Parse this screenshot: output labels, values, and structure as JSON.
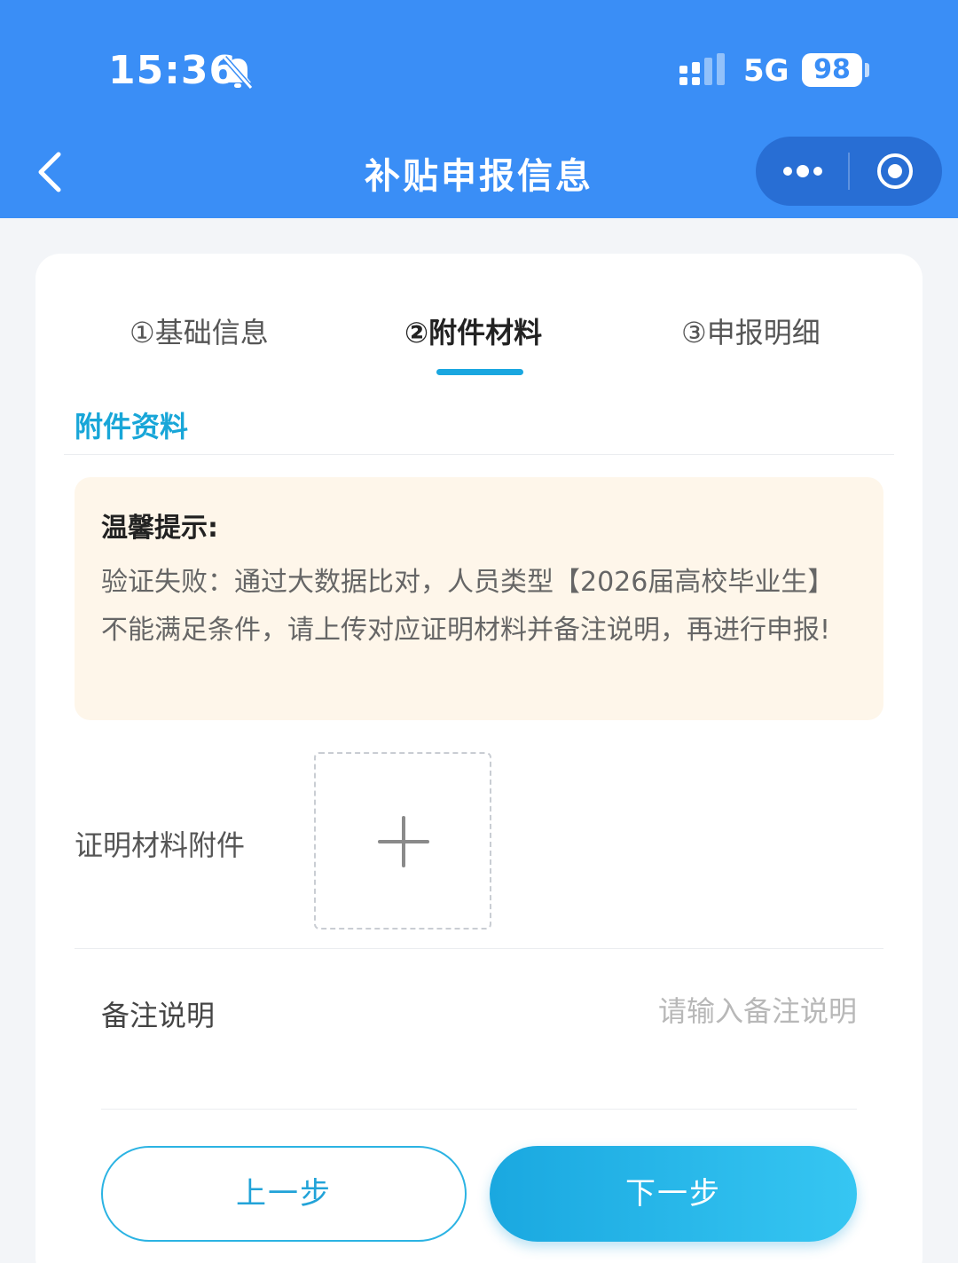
{
  "status_bar": {
    "time": "15:36",
    "network": "5G",
    "battery": "98"
  },
  "nav": {
    "title": "补贴申报信息"
  },
  "steps": [
    {
      "label": "①基础信息"
    },
    {
      "label": "②附件材料"
    },
    {
      "label": "③申报明细"
    }
  ],
  "section": {
    "title": "附件资料"
  },
  "notice": {
    "title": "温馨提示:",
    "body": "验证失败：通过大数据比对，人员类型【2026届高校毕业生】不能满足条件，请上传对应证明材料并备注说明，再进行申报!"
  },
  "attachment": {
    "label": "证明材料附件"
  },
  "remark": {
    "label": "备注说明",
    "placeholder": "请输入备注说明",
    "value": ""
  },
  "buttons": {
    "prev": "上一步",
    "next": "下一步"
  },
  "colors": {
    "brand_blue": "#3a8ef6",
    "accent_cyan": "#1aa7e0",
    "notice_bg": "#fef6ea"
  }
}
